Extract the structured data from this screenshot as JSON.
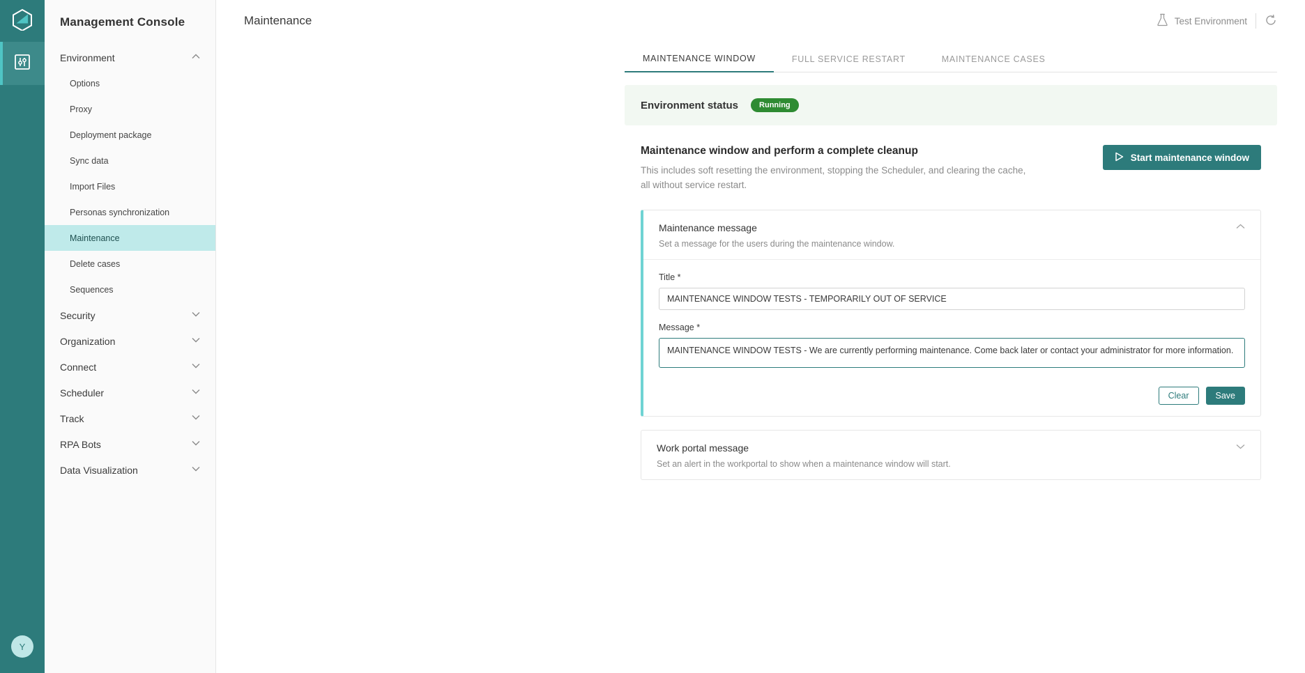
{
  "rail": {
    "logo_icon": "hexagon-logo-icon",
    "items": [
      {
        "name": "sliders-icon",
        "active": true
      }
    ],
    "avatar_initial": "Y"
  },
  "sidebar": {
    "title": "Management Console",
    "groups": [
      {
        "label": "Environment",
        "expanded": true,
        "chevron": "chevron-up-icon",
        "items": [
          {
            "label": "Options",
            "active": false
          },
          {
            "label": "Proxy",
            "active": false
          },
          {
            "label": "Deployment package",
            "active": false
          },
          {
            "label": "Sync data",
            "active": false
          },
          {
            "label": "Import Files",
            "active": false
          },
          {
            "label": "Personas synchronization",
            "active": false
          },
          {
            "label": "Maintenance",
            "active": true
          },
          {
            "label": "Delete cases",
            "active": false
          },
          {
            "label": "Sequences",
            "active": false
          }
        ]
      },
      {
        "label": "Security",
        "expanded": false,
        "chevron": "chevron-down-icon",
        "items": []
      },
      {
        "label": "Organization",
        "expanded": false,
        "chevron": "chevron-down-icon",
        "items": []
      },
      {
        "label": "Connect",
        "expanded": false,
        "chevron": "chevron-down-icon",
        "items": []
      },
      {
        "label": "Scheduler",
        "expanded": false,
        "chevron": "chevron-down-icon",
        "items": []
      },
      {
        "label": "Track",
        "expanded": false,
        "chevron": "chevron-down-icon",
        "items": []
      },
      {
        "label": "RPA Bots",
        "expanded": false,
        "chevron": "chevron-down-icon",
        "items": []
      },
      {
        "label": "Data Visualization",
        "expanded": false,
        "chevron": "chevron-down-icon",
        "items": []
      }
    ]
  },
  "header": {
    "title": "Maintenance",
    "environment_label": "Test Environment",
    "environment_icon": "flask-icon",
    "refresh_icon": "refresh-icon"
  },
  "tabs": [
    {
      "label": "MAINTENANCE WINDOW",
      "active": true
    },
    {
      "label": "FULL SERVICE RESTART",
      "active": false
    },
    {
      "label": "MAINTENANCE CASES",
      "active": false
    }
  ],
  "status": {
    "label": "Environment status",
    "badge": "Running",
    "badge_color": "#2e8b32",
    "banner_color": "#f2f8f2"
  },
  "section": {
    "title": "Maintenance window and perform a complete cleanup",
    "description_line1": "This includes soft resetting the environment, stopping the Scheduler, and clearing the cache,",
    "description_line2": "all without service restart.",
    "start_button": "Start maintenance window",
    "start_button_icon": "play-icon"
  },
  "maintenance_message_card": {
    "title": "Maintenance message",
    "subtitle": "Set a message for the users during the maintenance window.",
    "chevron": "chevron-up-icon",
    "title_field": {
      "label": "Title *",
      "value": "MAINTENANCE WINDOW TESTS - TEMPORARILY OUT OF SERVICE",
      "placeholder": "Title"
    },
    "message_field": {
      "label": "Message *",
      "value": "MAINTENANCE WINDOW TESTS - We are currently performing maintenance. Come back later or contact your administrator for more information.",
      "placeholder": "Message",
      "focused": true
    },
    "clear_button": "Clear",
    "save_button": "Save"
  },
  "work_portal_card": {
    "title": "Work portal message",
    "subtitle": "Set an alert in the workportal to show when a maintenance window will start.",
    "chevron": "chevron-down-icon"
  },
  "colors": {
    "brand_teal": "#2d7b7b",
    "accent_cyan": "#6fd3d3",
    "active_nav": "#bfeaea",
    "success_green": "#2e8b32"
  }
}
